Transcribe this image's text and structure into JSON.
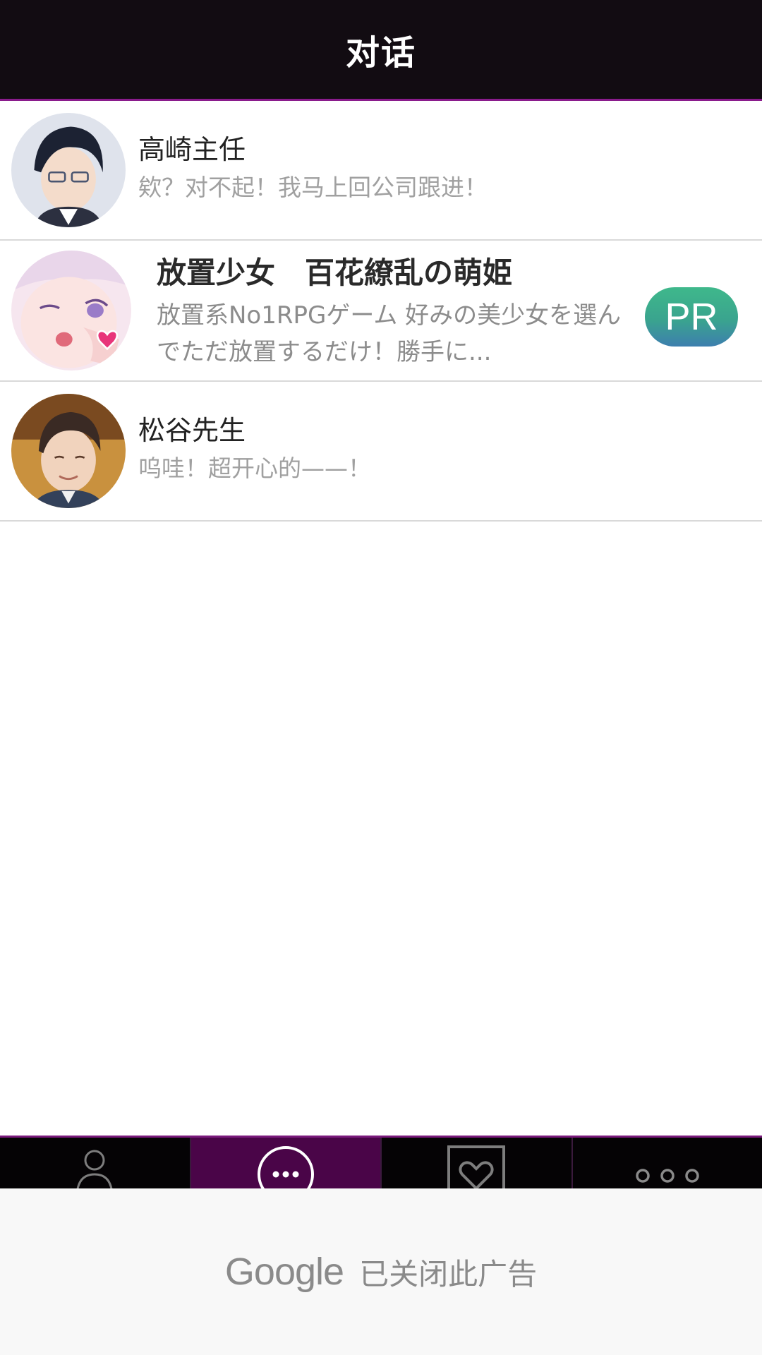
{
  "header": {
    "title": "对话"
  },
  "conversations": [
    {
      "name": "高崎主任",
      "preview": "欸？对不起！我马上回公司跟进！",
      "avatar": "male-glasses-avatar"
    },
    {
      "name": "放置少女　百花繚乱の萌姫",
      "preview": "放置系No1RPGゲーム 好みの美少女を選んでただ放置するだけ！勝手に...",
      "avatar": "anime-girl-avatar",
      "badge": "PR"
    },
    {
      "name": "松谷先生",
      "preview": "呜哇！超开心的——！",
      "avatar": "male-smile-avatar"
    }
  ],
  "tabbar": {
    "tabs": [
      {
        "icon": "person-icon",
        "active": false
      },
      {
        "icon": "chat-bubble-icon",
        "active": true
      },
      {
        "icon": "heart-frame-icon",
        "active": false
      },
      {
        "icon": "more-dots-icon",
        "active": false
      }
    ]
  },
  "ad": {
    "brand": "Google",
    "message": "已关闭此广告"
  },
  "colors": {
    "header_bg": "#120c12",
    "accent": "#8a1c8c",
    "active_tab": "#4a0548",
    "pr_badge": "#3fb88b"
  }
}
